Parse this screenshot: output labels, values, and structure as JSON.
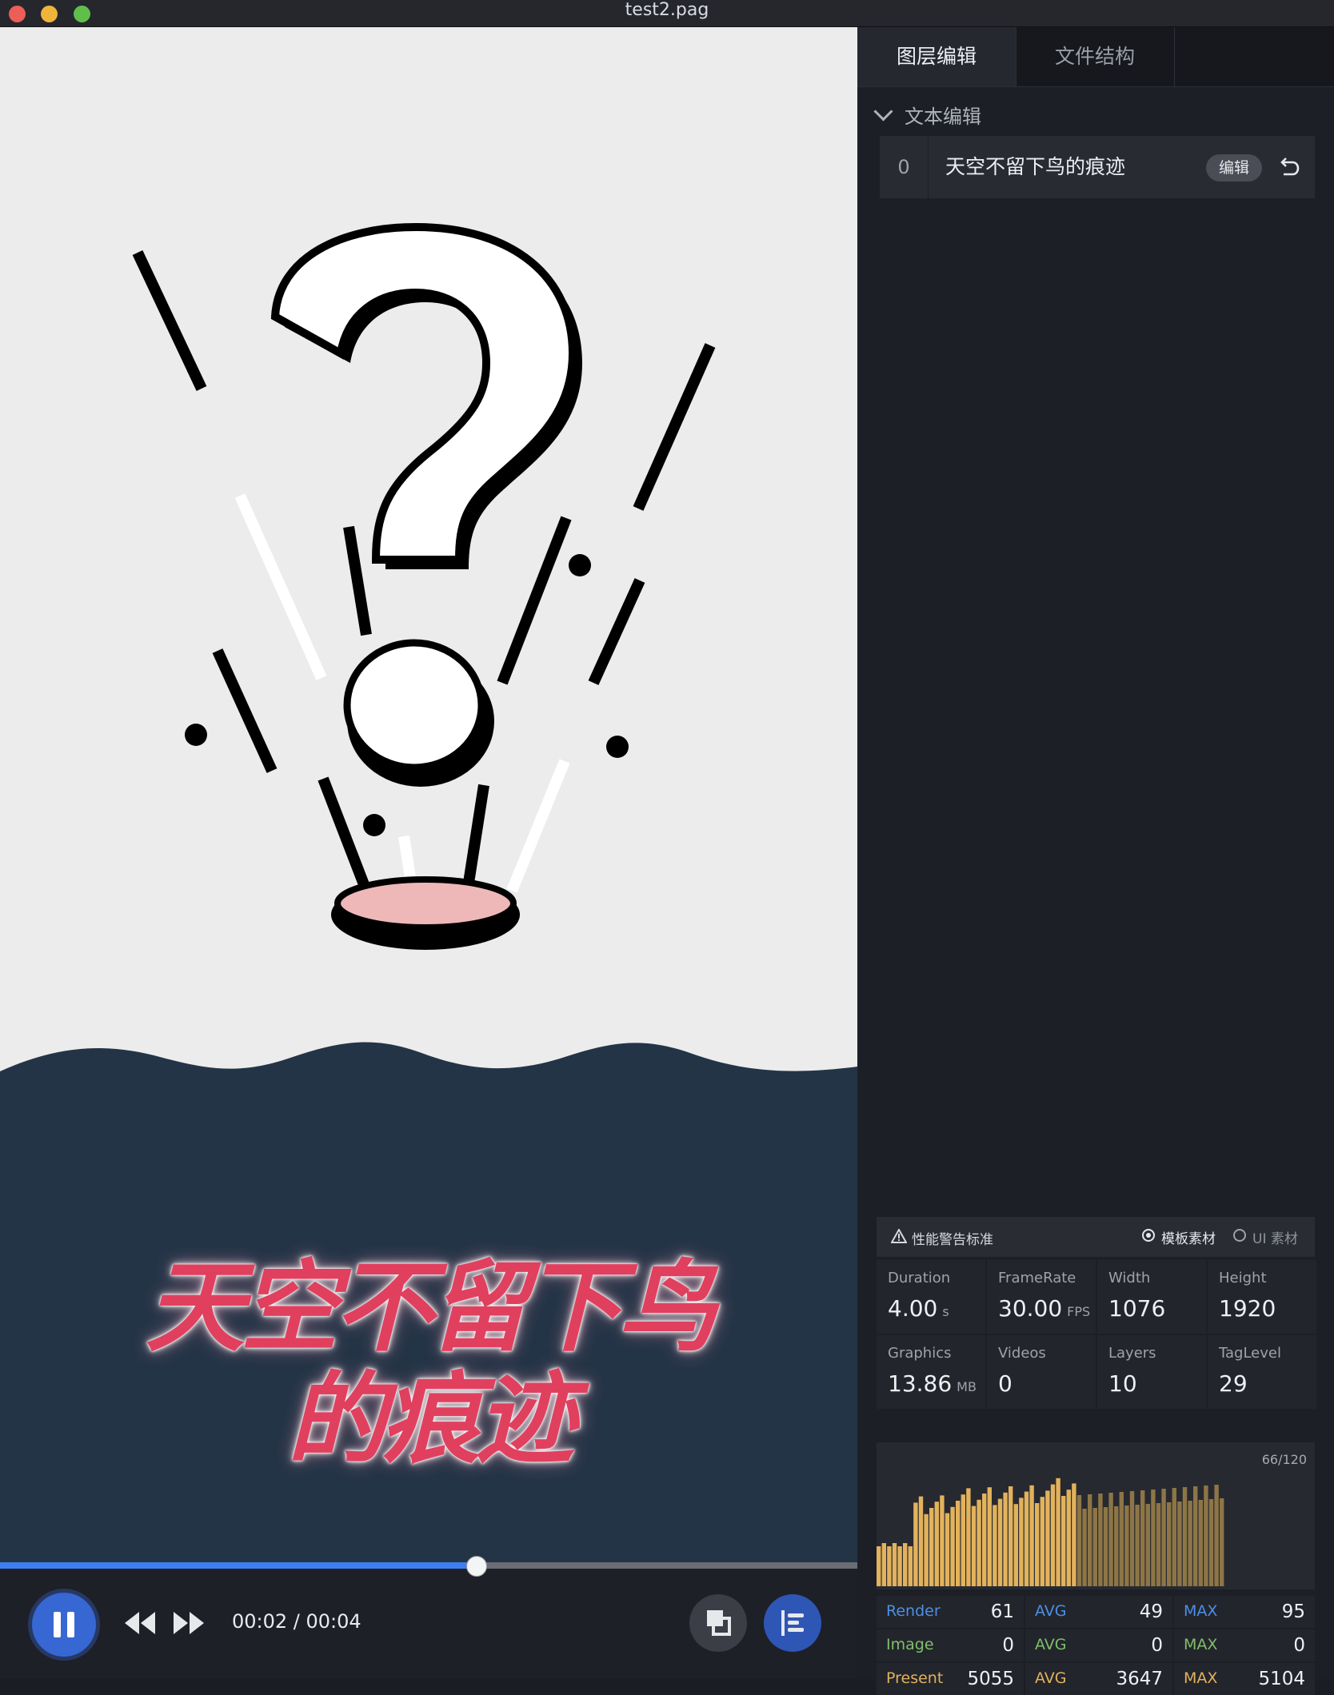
{
  "window": {
    "title": "test2.pag"
  },
  "preview": {
    "caption_line1": "天空不留下鸟",
    "caption_line2": "的痕迹",
    "colors": {
      "background": "#ececec",
      "wave": "#243447",
      "caption": "#e0405e",
      "hole_rim": "#efb8b8"
    }
  },
  "player": {
    "current_time": "00:02",
    "separator": " / ",
    "total_time": "00:04",
    "progress_fraction": 0.555,
    "state": "playing"
  },
  "tabs": [
    {
      "label": "图层编辑",
      "active": true
    },
    {
      "label": "文件结构",
      "active": false
    }
  ],
  "text_edit": {
    "section_title": "文本编辑",
    "rows": [
      {
        "index": "0",
        "text": "天空不留下鸟的痕迹",
        "edit_label": "编辑"
      }
    ]
  },
  "performance": {
    "warning_label": "性能警告标准",
    "options": [
      {
        "label": "模板素材",
        "selected": true
      },
      {
        "label": "UI 素材",
        "selected": false
      }
    ],
    "stats": [
      {
        "key": "Duration",
        "value": "4.00",
        "unit": "s"
      },
      {
        "key": "FrameRate",
        "value": "30.00",
        "unit": "FPS"
      },
      {
        "key": "Width",
        "value": "1076",
        "unit": ""
      },
      {
        "key": "Height",
        "value": "1920",
        "unit": ""
      },
      {
        "key": "Graphics",
        "value": "13.86",
        "unit": "MB"
      },
      {
        "key": "Videos",
        "value": "0",
        "unit": ""
      },
      {
        "key": "Layers",
        "value": "10",
        "unit": ""
      },
      {
        "key": "TagLevel",
        "value": "29",
        "unit": ""
      }
    ],
    "frame_count": "66/120",
    "chart_bar_color": "#e2b25c",
    "metrics": [
      {
        "name": "Render",
        "value": "61",
        "avg_label": "AVG",
        "avg": "49",
        "max_label": "MAX",
        "max": "95",
        "color": "#4b8fe6"
      },
      {
        "name": "Image",
        "value": "0",
        "avg_label": "AVG",
        "avg": "0",
        "max_label": "MAX",
        "max": "0",
        "color": "#7fbf6a"
      },
      {
        "name": "Present",
        "value": "5055",
        "avg_label": "AVG",
        "avg": "3647",
        "max_label": "MAX",
        "max": "5104",
        "color": "#e2b25c"
      }
    ]
  }
}
